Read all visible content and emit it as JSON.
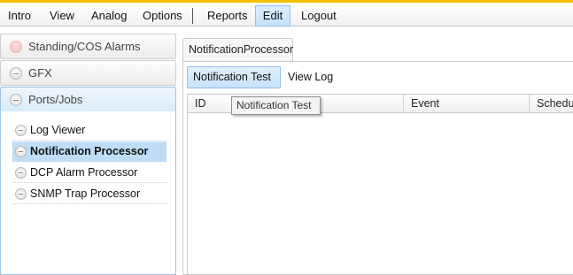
{
  "menu": {
    "items": [
      "Intro",
      "View",
      "Analog",
      "Options",
      "Reports",
      "Edit",
      "Logout"
    ],
    "active": "Edit"
  },
  "sidebar": {
    "sections": [
      {
        "label": "Standing/COS Alarms",
        "icon": "status-alarm-icon"
      },
      {
        "label": "GFX",
        "icon": "collapse-circle-icon"
      },
      {
        "label": "Ports/Jobs",
        "icon": "collapse-circle-icon",
        "expanded": true
      }
    ],
    "items": [
      {
        "label": "Log Viewer"
      },
      {
        "label": "Notification Processor",
        "selected": true
      },
      {
        "label": "DCP Alarm Processor"
      },
      {
        "label": "SNMP Trap Processor"
      }
    ]
  },
  "main": {
    "tab_title": "NotificationProcessor",
    "subtabs": [
      "Notification Test",
      "View Log"
    ],
    "active_subtab": "Notification Test",
    "columns": [
      "ID",
      "Event",
      "Schedule"
    ],
    "tooltip": "Notification Test"
  },
  "colors": {
    "accent_top": "#f2c200",
    "selection": "#bfddf7",
    "active_border": "#98c0e6"
  }
}
